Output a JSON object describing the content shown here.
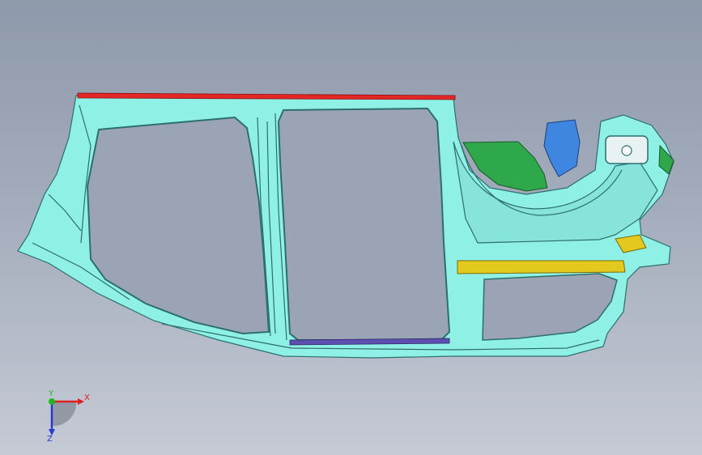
{
  "viewport": {
    "background_top": "#8e99aa",
    "background_bottom": "#c5cad5"
  },
  "model": {
    "colors": {
      "body": "#8ff0e6",
      "body_edge": "#2c6f6c",
      "roof_rail": "#e32626",
      "rear_panel": "#2ea84a",
      "sill_reinforcement": "#e3c91e",
      "bracket": "#3f86e0",
      "floor_seal": "#5d4fb0"
    }
  },
  "triad": {
    "x_label": "X",
    "y_label": "Y",
    "z_label": "Z",
    "x_color": "#e02020",
    "y_color": "#1fb81f",
    "z_color": "#2a3ad0"
  }
}
